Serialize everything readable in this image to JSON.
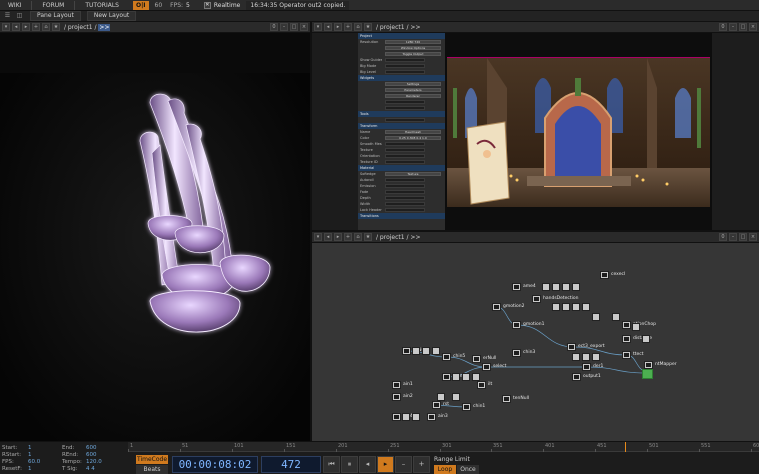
{
  "menu": {
    "items": [
      "WIKI",
      "FORUM",
      "TUTORIALS"
    ],
    "perf_badge": "O|I",
    "fps_value_small": "60",
    "fps_label": "FPS:",
    "fps": "5",
    "realtime_label": "Realtime",
    "status_message": "16:34:35 Operator out2 copied."
  },
  "layout_bar": {
    "tabs": [
      "Pane Layout",
      "New Layout"
    ]
  },
  "panes": {
    "left": {
      "path": "/ project1 /",
      "arrows": ">>",
      "count": "0"
    },
    "top_right": {
      "path": "/ project1 /",
      "arrows": ">>",
      "count": "0"
    },
    "bottom_right": {
      "path": "/ project1 /",
      "arrows": ">>",
      "count": "0"
    }
  },
  "parameters": {
    "rows": [
      {
        "type": "section",
        "label": "Project"
      },
      {
        "type": "row",
        "label": "Resolution",
        "value": "1280   720"
      },
      {
        "type": "row",
        "label": "",
        "value": "Window Options"
      },
      {
        "type": "row",
        "label": "",
        "value": "Toggle Output"
      },
      {
        "type": "row",
        "label": "Show Guides",
        "value": ""
      },
      {
        "type": "row",
        "label": "Big Mode",
        "value": ""
      },
      {
        "type": "row",
        "label": "Big Level",
        "value": ""
      },
      {
        "type": "section",
        "label": "Widgets"
      },
      {
        "type": "row",
        "label": "",
        "value": "Settings"
      },
      {
        "type": "row",
        "label": "",
        "value": "Parameters"
      },
      {
        "type": "row",
        "label": "",
        "value": "Renderer"
      },
      {
        "type": "row",
        "label": "",
        "value": ""
      },
      {
        "type": "row",
        "label": "",
        "value": ""
      },
      {
        "type": "section",
        "label": "Tools"
      },
      {
        "type": "row",
        "label": "",
        "value": ""
      },
      {
        "type": "section",
        "label": "Transform"
      },
      {
        "type": "row",
        "label": "Name",
        "value": "Headmesh"
      },
      {
        "type": "row",
        "label": "Color",
        "value": "0.25   0.308   0.4   1.0"
      },
      {
        "type": "row",
        "label": "Smooth Mesh",
        "value": ""
      },
      {
        "type": "row",
        "label": "Texture",
        "value": ""
      },
      {
        "type": "row",
        "label": "Orientation",
        "value": ""
      },
      {
        "type": "row",
        "label": "Texture ID",
        "value": ""
      },
      {
        "type": "section",
        "label": "Material"
      },
      {
        "type": "row",
        "label": "Softedge",
        "value": "Texture"
      },
      {
        "type": "row",
        "label": "Autoroll",
        "value": ""
      },
      {
        "type": "row",
        "label": "Emission",
        "value": ""
      },
      {
        "type": "row",
        "label": "Fade",
        "value": ""
      },
      {
        "type": "row",
        "label": "Depth",
        "value": ""
      },
      {
        "type": "row",
        "label": "Width",
        "value": ""
      },
      {
        "type": "row",
        "label": "Lock Header",
        "value": ""
      },
      {
        "type": "section",
        "label": "Transitions"
      }
    ]
  },
  "network_nodes": [
    {
      "label": "cexecl"
    },
    {
      "label": "ame4"
    },
    {
      "label": "handsDetection"
    },
    {
      "label": "gmotion2"
    },
    {
      "label": "gmotion1"
    },
    {
      "label": "ationChop"
    },
    {
      "label": "distance"
    },
    {
      "label": "ect3_export"
    },
    {
      "label": "chin3"
    },
    {
      "label": "erNull"
    },
    {
      "label": "n_Null"
    },
    {
      "label": "chin5"
    },
    {
      "label": "chin4"
    },
    {
      "label": "chin1"
    },
    {
      "label": "der1"
    },
    {
      "label": "output1"
    },
    {
      "label": "tenNull"
    },
    {
      "label": "ttect"
    },
    {
      "label": "ntMapper"
    },
    {
      "label": "ain1"
    },
    {
      "label": "ain2"
    },
    {
      "label": "ain4"
    },
    {
      "label": "ain3"
    },
    {
      "label": "select"
    },
    {
      "label": "rst"
    },
    {
      "label": "ilt"
    }
  ],
  "timeline": {
    "stats": [
      {
        "k": "Start:",
        "v": "1",
        "k2": "End:",
        "v2": "600"
      },
      {
        "k": "RStart:",
        "v": "1",
        "k2": "REnd:",
        "v2": "600"
      },
      {
        "k": "FPS:",
        "v": "60.0",
        "k2": "Tempo:",
        "v2": "120.0"
      },
      {
        "k": "ResetF:",
        "v": "1",
        "k2": "T Sig:",
        "v2": "4   4"
      }
    ],
    "ruler_ticks": [
      "1",
      "51",
      "101",
      "151",
      "201",
      "251",
      "301",
      "351",
      "401",
      "451",
      "501",
      "551",
      "600"
    ],
    "timecode_label": "TimeCode",
    "beats_label": "Beats",
    "timecode": "00:00:08:02",
    "frame": "472",
    "range_limit_label": "Range Limit",
    "loop_label": "Loop",
    "once_label": "Once",
    "playhead_fraction": 0.787
  }
}
